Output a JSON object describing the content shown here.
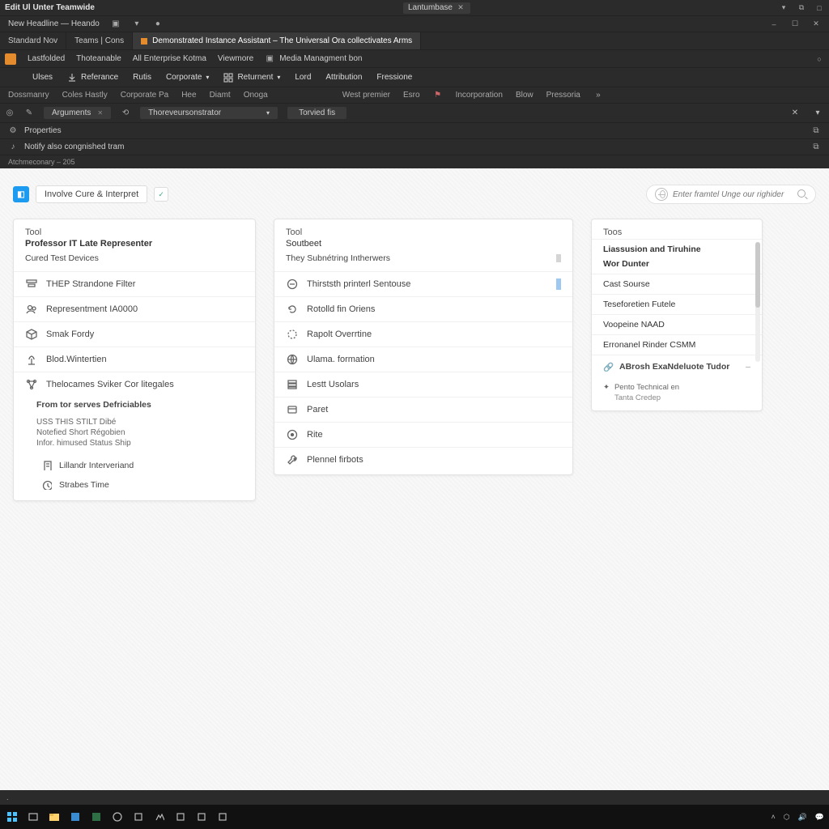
{
  "titlebar": {
    "appTitle": "Edit Ul Unter Teamwide",
    "subTitle": "New Headline — Heando",
    "centerTab": "Lantumbase",
    "winButtons": [
      "min",
      "max",
      "close"
    ]
  },
  "menu": {
    "items": [
      "Standard Nov",
      "Teams | Cons",
      "Demonstrated Instance Assistant – The Universal Ora collectivates Arms"
    ]
  },
  "subtool": {
    "a": "Lastfolded",
    "b": "Thoteanable",
    "c": "All Enterprise Kotma",
    "d": "Viewmore",
    "e": "Media Managment bon"
  },
  "ribbon": {
    "items": [
      "Ulses",
      "Referance",
      "Rutis",
      "Corporate",
      "Returnent",
      "Lord",
      "Attribution",
      "Fressione"
    ]
  },
  "ribbon2": {
    "left": [
      "Dossmanry",
      "Coles Hastly",
      "Corporate Pa",
      "Hee",
      "Diamt",
      "Onoga"
    ],
    "right": [
      "West premier",
      "Esro",
      "Incorporation",
      "Blow",
      "Pressoria"
    ]
  },
  "props": {
    "pill1": "Arguments",
    "pill2": "Thoreveursonstrator",
    "tab": "Torvied fis"
  },
  "subline1": "Properties",
  "subline2": "Notify also congnished tram",
  "smallline": "Atchmeconary – 205",
  "breadcrumb": {
    "text": "Involve Cure & Interpret"
  },
  "search": {
    "placeholder": "Enter framtel Unge our righider"
  },
  "card1": {
    "header": "Tool",
    "title1": "Professor IT Late Representer",
    "title2": "Cured Test Devices",
    "items": [
      "THEP Strandone Filter",
      "Representment IA0000",
      "Smak Fordy",
      "Blod.Wintertien",
      "Thelocames Sviker Cor litegales"
    ],
    "indent": {
      "title": "From tor serves Defriciables",
      "line1": "USS THIS STILT Dibé",
      "line2": "Notefied Short Régobien",
      "line3": "Infor. himused Status Ship",
      "sub": [
        "Lillandr Interveriand",
        "Strabes Time"
      ]
    }
  },
  "card2": {
    "header": "Tool",
    "sub1": "Soutbeet",
    "sub2": "They Subnétring Intherwers",
    "items": [
      "Thirststh printerl Sentouse",
      "Rotolld fin Oriens",
      "Rapolt Overrtine",
      "Ulama. formation",
      "Lestt Usolars",
      "Paret",
      "Rite",
      "Plennel firbots"
    ]
  },
  "card3": {
    "header": "Toos",
    "rows": [
      "Liassusion and Tiruhine",
      "Wor Dunter",
      "Cast Sourse",
      "Teseforetien Futele",
      "Voopeine NAAD",
      "Erronanel Rinder CSMM"
    ],
    "emph": "ABrosh ExaNdeluote Tudor",
    "foot1": "Pento Technical en",
    "foot2": "Tanta Credep"
  },
  "statusbar": {
    "text": "."
  },
  "taskbar": {
    "clock": ""
  }
}
